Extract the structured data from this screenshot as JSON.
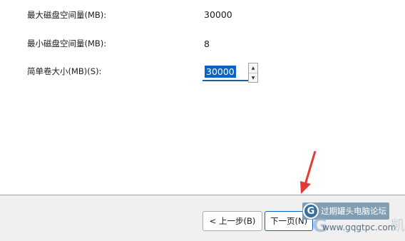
{
  "fields": [
    {
      "label": "最大磁盘空间量(MB):",
      "value": "30000"
    },
    {
      "label": "最小磁盘空间量(MB):",
      "value": "8"
    },
    {
      "label": "简单卷大小(MB)(S):",
      "value": "30000"
    }
  ],
  "spin_buttons": {
    "up_icon": "triangle-up-icon",
    "down_icon": "triangle-down-icon"
  },
  "buttons": {
    "back": "< 上一步(B)",
    "next": "下一页(N)"
  },
  "annotation": {
    "icon": "red-arrow-icon",
    "color": "#e53935"
  },
  "watermark": {
    "logo_letter": "G",
    "title": "过期罐头电脑论坛",
    "url": "www.gqgtpc.com",
    "partial_char": "凯"
  },
  "colors": {
    "accent": "#0a64c8",
    "footer": "#f0f0f0"
  }
}
